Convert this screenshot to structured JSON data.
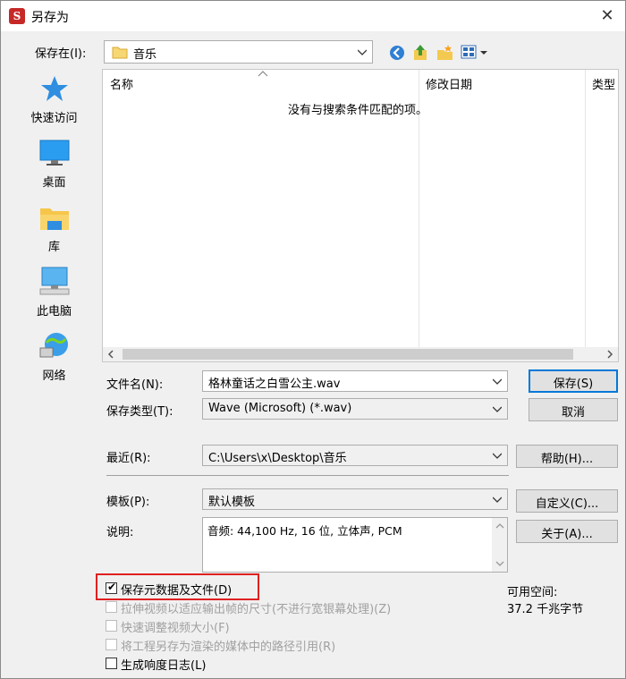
{
  "window": {
    "title": "另存为",
    "close_glyph": "✕",
    "app_icon_letter": "S"
  },
  "save_in": {
    "label": "保存在(I):",
    "value": "音乐"
  },
  "places": [
    {
      "label": "快速访问",
      "icon": "star-icon"
    },
    {
      "label": "桌面",
      "icon": "desktop-icon"
    },
    {
      "label": "库",
      "icon": "library-folder-icon"
    },
    {
      "label": "此电脑",
      "icon": "computer-icon"
    },
    {
      "label": "网络",
      "icon": "network-icon"
    }
  ],
  "file_list": {
    "columns": [
      "名称",
      "修改日期",
      "类型"
    ],
    "empty_message": "没有与搜索条件匹配的项。"
  },
  "filename": {
    "label": "文件名(N):",
    "value": "格林童话之白雪公主.wav"
  },
  "filetype": {
    "label": "保存类型(T):",
    "value": "Wave (Microsoft) (*.wav)"
  },
  "buttons": {
    "save": "保存(S)",
    "cancel": "取消",
    "help": "帮助(H)...",
    "customize": "自定义(C)...",
    "about": "关于(A)..."
  },
  "recent": {
    "label": "最近(R):",
    "value": "C:\\Users\\x\\Desktop\\音乐"
  },
  "template": {
    "label": "模板(P):",
    "value": "默认模板"
  },
  "description": {
    "label": "说明:",
    "value": "音频: 44,100 Hz, 16 位, 立体声, PCM"
  },
  "checkboxes": [
    {
      "label": "保存元数据及文件(D)",
      "checked": true,
      "enabled": true
    },
    {
      "label": "拉伸视频以适应输出帧的尺寸(不进行宽银幕处理)(Z)",
      "checked": false,
      "enabled": false
    },
    {
      "label": "快速调整视频大小(F)",
      "checked": false,
      "enabled": false
    },
    {
      "label": "将工程另存为渲染的媒体中的路径引用(R)",
      "checked": false,
      "enabled": false
    },
    {
      "label": "生成响度日志(L)",
      "checked": false,
      "enabled": true
    }
  ],
  "free_space": {
    "label": "可用空间:",
    "value": "37.2 千兆字节"
  },
  "colors": {
    "highlight_border": "#e02020",
    "default_button_border": "#0078d7"
  }
}
